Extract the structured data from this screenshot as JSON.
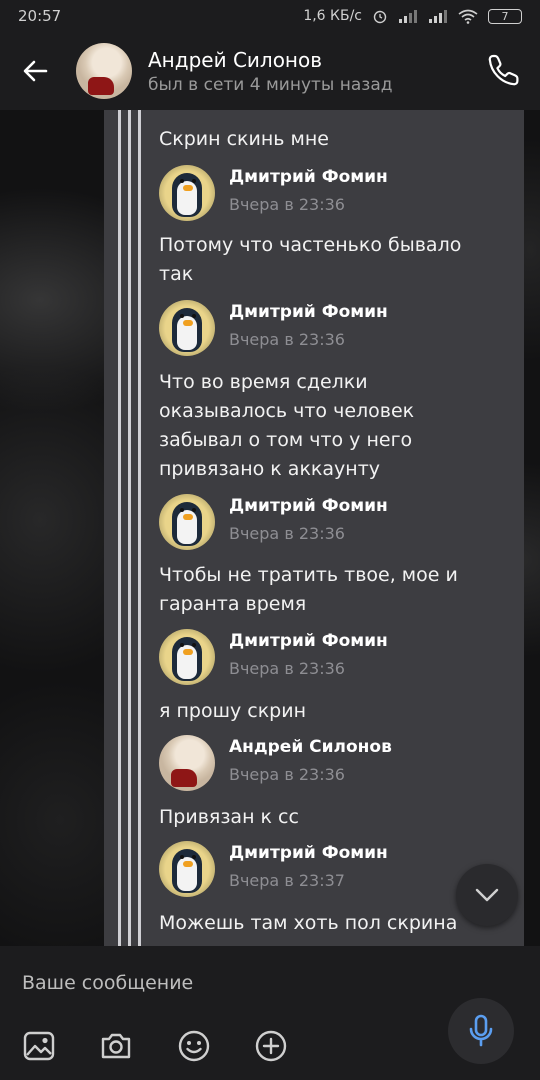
{
  "status_bar": {
    "time": "20:57",
    "network_speed": "1,6 КБ/с",
    "battery": "7",
    "icons": [
      "alarm-icon",
      "signal-icon",
      "signal-icon",
      "wifi-icon",
      "battery-icon"
    ]
  },
  "header": {
    "contact_name": "Андрей Силонов",
    "last_seen": "был в сети 4 минуты назад",
    "icons": [
      "back-arrow-icon",
      "phone-icon"
    ]
  },
  "messages": [
    {
      "text": "Скрин скинь мне"
    },
    {
      "sender": "Дмитрий Фомин",
      "time": "Вчера в 23:36",
      "avatar": "penguin",
      "text": "Потому что частенько бывало так"
    },
    {
      "sender": "Дмитрий Фомин",
      "time": "Вчера в 23:36",
      "avatar": "penguin",
      "text": "Что во время сделки оказывалось что человек забывал о том что у него привязано к аккаунту"
    },
    {
      "sender": "Дмитрий Фомин",
      "time": "Вчера в 23:36",
      "avatar": "penguin",
      "text": "Чтобы не тратить твое, мое и гаранта время"
    },
    {
      "sender": "Дмитрий Фомин",
      "time": "Вчера в 23:36",
      "avatar": "penguin",
      "text": "я прошу скрин"
    },
    {
      "sender": "Андрей Силонов",
      "time": "Вчера в 23:36",
      "avatar": "andrey",
      "text": "Привязан к сс"
    },
    {
      "sender": "Дмитрий Фомин",
      "time": "Вчера в 23:37",
      "avatar": "penguin",
      "text": "Можешь там хоть пол скрина"
    }
  ],
  "composer": {
    "placeholder": "Ваше сообщение",
    "icons": [
      "image-icon",
      "camera-icon",
      "emoji-icon",
      "add-icon",
      "microphone-icon"
    ]
  },
  "colors": {
    "background": "#121213",
    "bar": "#1c1c1e",
    "forward_panel": "#3d3d41",
    "accent": "#5b9ef0",
    "secondary_text": "#8e8e93"
  }
}
